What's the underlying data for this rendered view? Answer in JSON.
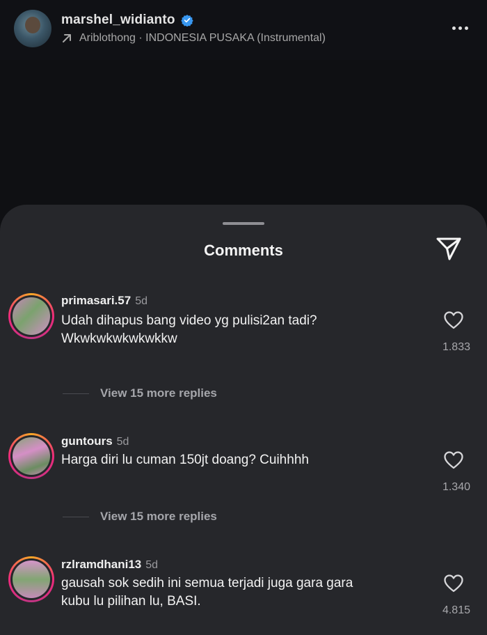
{
  "header": {
    "username": "marshel_widianto",
    "music": "Ariblothong · INDONESIA PUSAKA (Instrumental)"
  },
  "sheet": {
    "title": "Comments"
  },
  "comments": [
    {
      "username": "primasari.57",
      "time": "5d",
      "text_line1": "Udah dihapus bang video yg pulisi2an tadi?",
      "text_line2": "Wkwkwkwkwkwkkw",
      "likes": "1.833",
      "replies": "View 15 more replies"
    },
    {
      "username": "guntours",
      "time": "5d",
      "text_line1": "Harga diri lu cuman 150jt doang? Cuihhhh",
      "likes": "1.340",
      "replies": "View 15 more replies"
    },
    {
      "username": "rzlramdhani13",
      "time": "5d",
      "text_line1": "gausah sok sedih ini semua terjadi juga gara gara",
      "text_line2": "kubu lu pilihan lu, BASI.",
      "likes": "4.815"
    }
  ],
  "colors": {
    "background": "#0f1013",
    "sheet": "#26272b",
    "verified": "#3897f0"
  },
  "icons": [
    "verified-badge-icon",
    "arrow-up-right-icon",
    "more-horizontal-icon",
    "send-icon",
    "heart-icon"
  ]
}
